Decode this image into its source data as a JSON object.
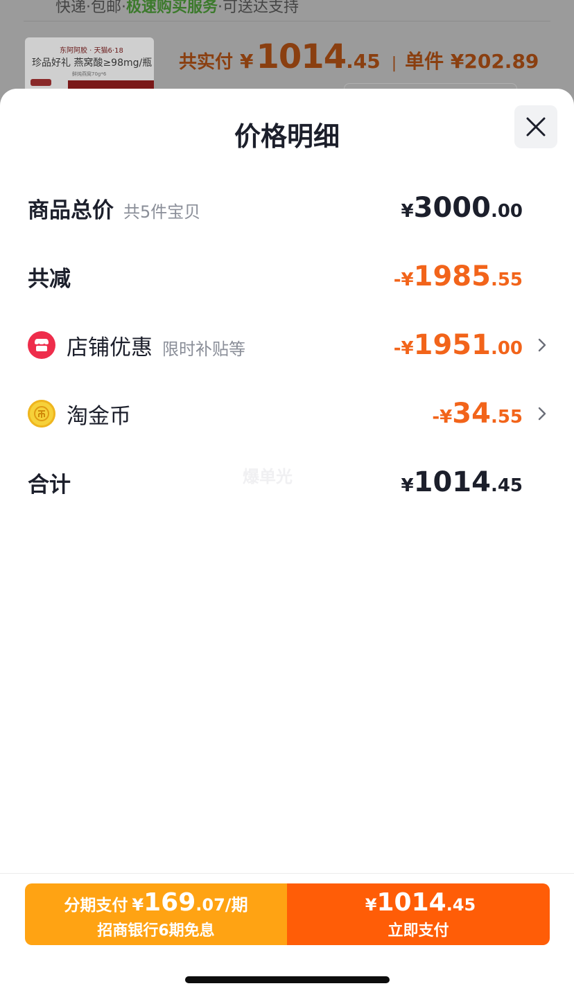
{
  "background": {
    "top_line_prefix": "快递·包邮·",
    "top_line_highlight": "极速购买服务",
    "top_line_suffix": "·可送达支持",
    "product_brand": "东阿阿胶 · 天猫6·18",
    "product_name": "珍品好礼 燕窝酸≥98mg/瓶",
    "product_sub": "鲜炖燕窝70g*6",
    "total_paid_label": "共实付",
    "total_paid_yen": "¥",
    "total_paid_int": "1014",
    "total_paid_dec": ".45",
    "separator": "|",
    "unit_price": "单件 ¥202.89"
  },
  "sheet": {
    "title": "价格明细",
    "close_icon": "close-icon",
    "rows": {
      "goods_total": {
        "label": "商品总价",
        "hint": "共5件宝贝",
        "yen": "¥",
        "int": "3000",
        "dec": ".00"
      },
      "total_discount": {
        "label": "共减",
        "yen": "-¥",
        "int": "1985",
        "dec": ".55"
      },
      "shop_discount": {
        "icon": "shop-icon",
        "label": "店铺优惠",
        "hint": "限时补贴等",
        "yen": "-¥",
        "int": "1951",
        "dec": ".00"
      },
      "taojinbi": {
        "icon": "coin-icon",
        "label": "淘金币",
        "yen": "-¥",
        "int": "34",
        "dec": ".55"
      },
      "total": {
        "label": "合计",
        "yen": "¥",
        "int": "1014",
        "dec": ".45"
      }
    },
    "watermark": "爆单光"
  },
  "footer": {
    "installment": {
      "label": "分期支付",
      "yen": "¥",
      "int": "169",
      "dec": ".07/期",
      "sub": "招商银行6期免息"
    },
    "pay_now": {
      "yen": "¥",
      "int": "1014",
      "dec": ".45",
      "label": "立即支付"
    }
  },
  "colors": {
    "accent_orange": "#f2641a",
    "install_button": "#ffa313",
    "pay_button": "#ff5d07",
    "text_dark": "#1c1f2b",
    "hint_gray": "#8a8e98"
  }
}
